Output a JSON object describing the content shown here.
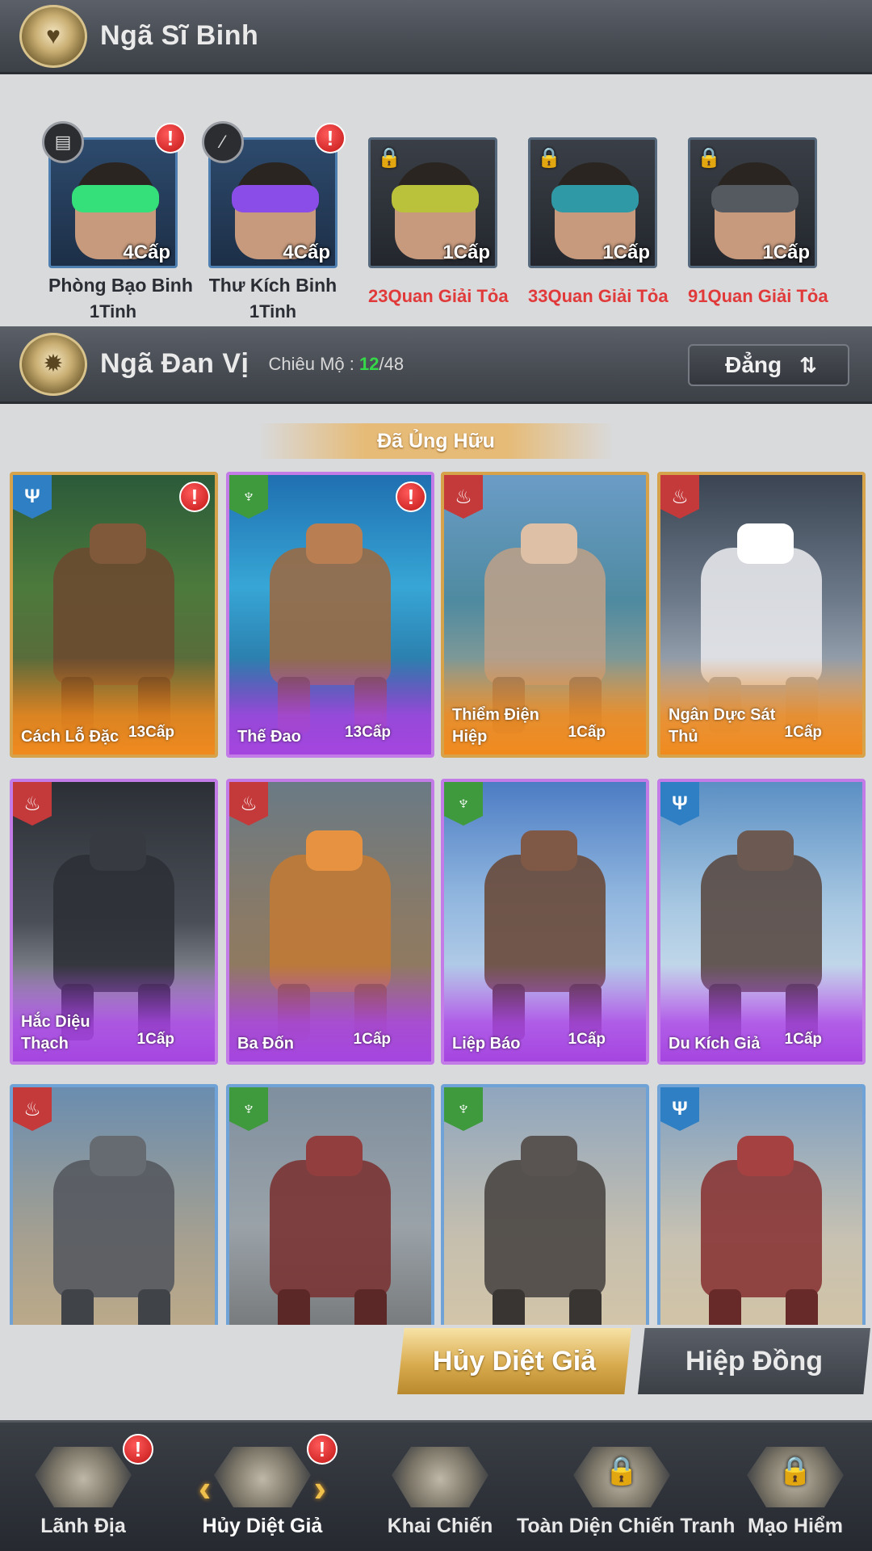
{
  "soldier_section": {
    "title": "Ngã Sĩ Binh"
  },
  "soldiers": [
    {
      "name": "Phòng Bạo Binh",
      "level": "4Cấp",
      "sub": "1Tinh",
      "locked": false,
      "visor": "#35e07a",
      "badge": "▤",
      "alert": "!"
    },
    {
      "name": "Thư Kích Binh",
      "level": "4Cấp",
      "sub": "1Tinh",
      "locked": false,
      "visor": "#8a4de8",
      "badge": "⁄",
      "alert": "!"
    },
    {
      "level": "1Cấp",
      "unlock": "23Quan Giải Tỏa",
      "locked": true,
      "visor": "#b9c23a"
    },
    {
      "level": "1Cấp",
      "unlock": "33Quan Giải Tỏa",
      "locked": true,
      "visor": "#2f9aa6"
    },
    {
      "level": "1Cấp",
      "unlock": "91Quan Giải Tỏa",
      "locked": true,
      "visor": "#555a61"
    }
  ],
  "unit_section": {
    "title": "Ngã Đan Vị",
    "recruit_label": "Chiêu Mộ :",
    "recruit_current": "12",
    "recruit_total": "/48",
    "sort_label": "Đẳng",
    "sort_icon": "⇅"
  },
  "owned_banner": "Đã Ủng Hữu",
  "units": [
    {
      "name": "Cách Lỗ Đặc",
      "level": "13Cấp",
      "frame": "gold",
      "type": "blue",
      "alert": "!",
      "bg": "linear-gradient(180deg,#2b5a3a 0%,#4c7a3c 40%,#6a5a3a 100%)",
      "mech": "#6b4a30"
    },
    {
      "name": "Thế Đao",
      "level": "13Cấp",
      "frame": "purple",
      "type": "green",
      "alert": "!",
      "bg": "linear-gradient(180deg,#1f6fb0 0%,#37a6d6 40%,#1c4e7a 100%)",
      "mech": "#9a6a44"
    },
    {
      "name": "Thiểm Điện Hiệp",
      "level": "1Cấp",
      "frame": "gold",
      "type": "red",
      "bg": "linear-gradient(180deg,#6b9cc7 0%,#4e8aa0 45%,#c9b08a 100%)",
      "mech": "#b9a08a"
    },
    {
      "name": "Ngân Dực Sát Thủ",
      "level": "1Cấp",
      "frame": "gold",
      "type": "red",
      "bg": "linear-gradient(180deg,#3a4452 0%,#6d7a8a 45%,#cfd6de 100%)",
      "mech": "#e4e6ea"
    },
    {
      "name": "Hắc Diệu Thạch",
      "level": "1Cấp",
      "frame": "purple",
      "type": "red",
      "bg": "linear-gradient(180deg,#2c2f36 0%,#4a4f57 50%,#d8dde4 100%)",
      "mech": "#2e3036"
    },
    {
      "name": "Ba Đốn",
      "level": "1Cấp",
      "frame": "purple",
      "type": "red",
      "bg": "linear-gradient(180deg,#6a7a85 0%,#8a7a66 50%,#9a7a55 100%)",
      "mech": "#c07a36"
    },
    {
      "name": "Liệp Báo",
      "level": "1Cấp",
      "frame": "purple",
      "type": "green",
      "bg": "linear-gradient(180deg,#4c7cc4 0%,#8fb5de 40%,#dbe6f2 100%)",
      "mech": "#6a4a3a"
    },
    {
      "name": "Du Kích Giả",
      "level": "1Cấp",
      "frame": "purple",
      "type": "blue",
      "bg": "linear-gradient(180deg,#5b8fc4 0%,#a8c8e2 45%,#e8eef4 100%)",
      "mech": "#5a4a44"
    },
    {
      "name": "",
      "level": "",
      "frame": "blue",
      "type": "red",
      "bg": "linear-gradient(180deg,#6a8db0 0%,#a6a090 55%,#c6ae86 100%)",
      "mech": "#55595f"
    },
    {
      "name": "",
      "level": "",
      "frame": "blue",
      "type": "green",
      "bg": "linear-gradient(180deg,#7f8f9f 0%,#9aa2a8 50%,#6a6b6b 100%)",
      "mech": "#7a3434"
    },
    {
      "name": "",
      "level": "",
      "frame": "blue",
      "type": "green",
      "bg": "linear-gradient(180deg,#8fa6bf 0%,#c6bfae 55%,#d8c8a6 100%)",
      "mech": "#4a4644"
    },
    {
      "name": "",
      "level": "",
      "frame": "blue",
      "type": "blue",
      "bg": "linear-gradient(180deg,#7fa0c2 0%,#c8c2b2 55%,#d6c4a0 100%)",
      "mech": "#8a3636"
    }
  ],
  "tabs": [
    {
      "label": "Hủy Diệt Giả",
      "active": true
    },
    {
      "label": "Hiệp  Đồng",
      "active": false
    }
  ],
  "bottom_nav": [
    {
      "label": "Lãnh Địa",
      "alert": "!",
      "locked": false,
      "active": false
    },
    {
      "label": "Hủy Diệt Giả",
      "alert": "!",
      "locked": false,
      "active": true
    },
    {
      "label": "Khai Chiến",
      "locked": false,
      "active": false
    },
    {
      "label": "Toàn Diện Chiến Tranh",
      "locked": true,
      "active": false
    },
    {
      "label": "Mạo Hiểm",
      "locked": true,
      "active": false
    }
  ],
  "colors": {
    "gold_frame": "#d6a24a",
    "purple_frame": "#c37be8",
    "blue_frame": "#6fa2d6",
    "alert": "#d42020",
    "unlock_text": "#e03a3a",
    "recruit_highlight": "#36d84a"
  }
}
